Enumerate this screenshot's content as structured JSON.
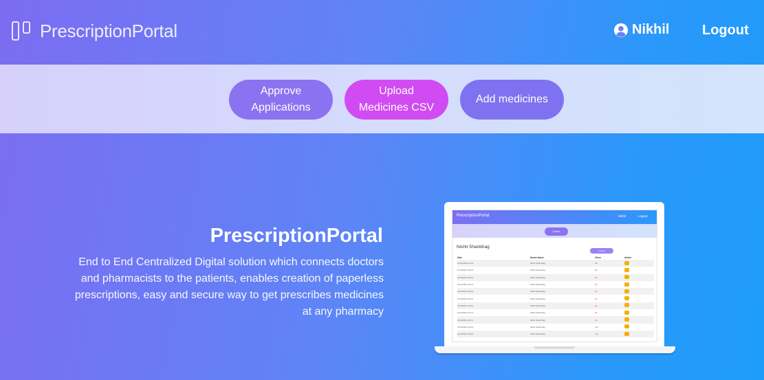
{
  "header": {
    "brand": "PrescriptionPortal",
    "user_name": "Nikhil",
    "logout": "Logout"
  },
  "actions": {
    "approve_line1": "Approve",
    "approve_line2": "Applications",
    "upload_line1": "Upload",
    "upload_line2": "Medicines CSV",
    "add": "Add medicines"
  },
  "hero": {
    "title": "PrescriptionPortal",
    "description": "End to End Centralized Digital solution which connects doctors and pharmacists to the patients, enables creation of paperless prescriptions, easy and secure way to get prescribes medicines at any pharmacy"
  },
  "mockup": {
    "brand": "PrescriptionPortal",
    "user": "Nikhil",
    "logout": "Logout",
    "band_button": "Orders",
    "patient_name": "Nishit Shanbhag",
    "create_button": "Create",
    "columns": [
      "Date",
      "Doctor Name",
      "Given",
      "Action"
    ],
    "rows": [
      {
        "date": "11/10/2021 00:13",
        "doctor": "Nishit Shanbhag",
        "given": "No"
      },
      {
        "date": "10/10/2021 18:15",
        "doctor": "Nishit Shanbhag",
        "given": "No"
      },
      {
        "date": "10/10/2021 18:13",
        "doctor": "Nishit Shanbhag",
        "given": "No"
      },
      {
        "date": "10/10/2021 18:12",
        "doctor": "Nishit Shanbhag",
        "given": "No"
      },
      {
        "date": "10/10/2021 18:12",
        "doctor": "Nishit Shanbhag",
        "given": "No"
      },
      {
        "date": "10/10/2021 18:12",
        "doctor": "Nishit Shanbhag",
        "given": "No"
      },
      {
        "date": "10/10/2021 18:12",
        "doctor": "Nishit Shanbhag",
        "given": "No"
      },
      {
        "date": "10/10/2021 18:12",
        "doctor": "Nishit Shanbhag",
        "given": "No"
      },
      {
        "date": "10/10/2021 18:11",
        "doctor": "Nishit Shanbhag",
        "given": "No"
      },
      {
        "date": "10/10/2021 18:10",
        "doctor": "Nishit Shanbhag",
        "given": "Yes"
      },
      {
        "date": "10/10/2021 18:10",
        "doctor": "Nishit Shanbhag",
        "given": "Yes"
      }
    ]
  },
  "colors": {
    "approve": "#8b72f0",
    "upload": "#d14bf2",
    "add": "#7f72f1",
    "action_icon": "#f3b200"
  }
}
